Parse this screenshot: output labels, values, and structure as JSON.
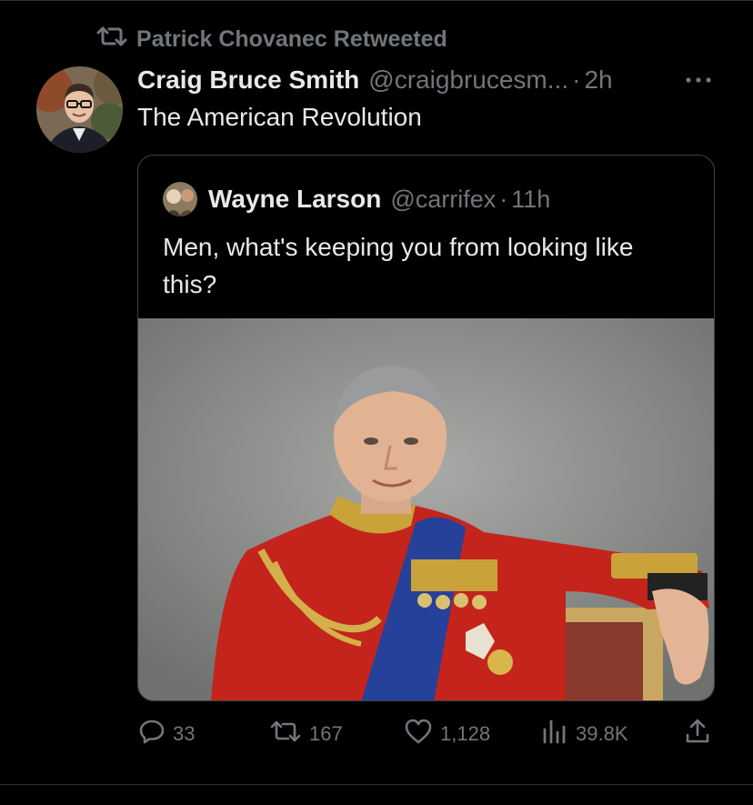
{
  "retweet": {
    "label": "Patrick Chovanec Retweeted"
  },
  "tweet": {
    "author_name": "Craig Bruce Smith",
    "author_handle": "@craigbrucesm...",
    "separator": "·",
    "time": "2h",
    "text": "The American Revolution"
  },
  "quote": {
    "author_name": "Wayne Larson",
    "author_handle": "@carrifex",
    "separator": "·",
    "time": "11h",
    "text": "Men, what's keeping you from looking like this?"
  },
  "actions": {
    "replies": "33",
    "retweets": "167",
    "likes": "1,128",
    "views": "39.8K"
  },
  "icons": [
    "retweet-icon",
    "more-icon",
    "reply-icon",
    "like-icon",
    "views-icon",
    "share-icon"
  ],
  "colors": {
    "background": "#000000",
    "text": "#e7e9ea",
    "muted": "#71767b",
    "border": "#2f3336"
  }
}
